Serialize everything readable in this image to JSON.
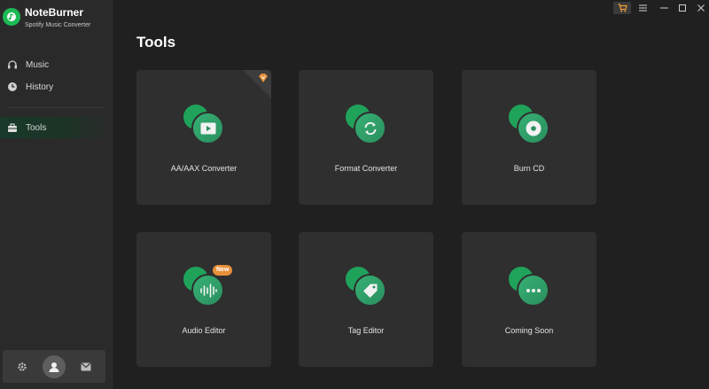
{
  "app": {
    "name": "NoteBurner",
    "subtitle": "Spotify Music Converter"
  },
  "sidebar": {
    "items": [
      {
        "label": "Music",
        "icon": "headphones-icon"
      },
      {
        "label": "History",
        "icon": "clock-icon"
      },
      {
        "label": "Tools",
        "icon": "toolbox-icon",
        "active": true
      }
    ],
    "bottom": [
      "gear-icon",
      "avatar-icon",
      "mail-icon"
    ]
  },
  "titlebar": {
    "buttons": [
      "cart-icon",
      "menu-icon",
      "minimize-icon",
      "maximize-icon",
      "close-icon"
    ]
  },
  "main": {
    "title": "Tools",
    "cards": [
      {
        "label": "AA/AAX Converter",
        "icon": "play-icon",
        "corner": "premium-icon"
      },
      {
        "label": "Format Converter",
        "icon": "refresh-icon"
      },
      {
        "label": "Burn CD",
        "icon": "disc-icon"
      },
      {
        "label": "Audio Editor",
        "icon": "waveform-icon",
        "badge": "New"
      },
      {
        "label": "Tag Editor",
        "icon": "tag-icon"
      },
      {
        "label": "Coming Soon",
        "icon": "more-icon"
      }
    ]
  },
  "colors": {
    "accent": "#1fa35b",
    "badge": "#e8903a",
    "background": "#202020",
    "card": "#2f2f2f"
  }
}
